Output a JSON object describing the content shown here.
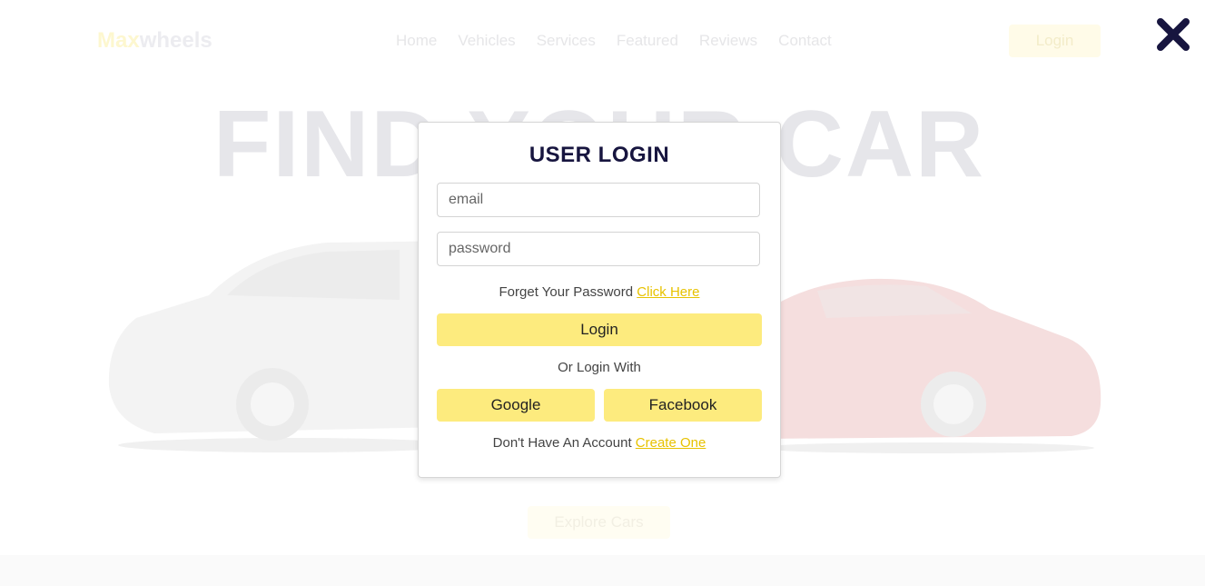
{
  "header": {
    "logo_part1": "Max",
    "logo_part2": "wheels",
    "nav": [
      "Home",
      "Vehicles",
      "Services",
      "Featured",
      "Reviews",
      "Contact"
    ],
    "login_label": "Login"
  },
  "hero": {
    "title": "FIND YOUR CAR",
    "explore_label": "Explore Cars"
  },
  "modal": {
    "title": "USER LOGIN",
    "email_placeholder": "email",
    "password_placeholder": "password",
    "forgot_text": "Forget Your Password",
    "forgot_link": "Click Here",
    "login_button": "Login",
    "or_text": "Or Login With",
    "google_button": "Google",
    "facebook_button": "Facebook",
    "signup_text": "Don't Have An Account",
    "signup_link": "Create One"
  },
  "icons": {
    "close": "close-icon"
  },
  "colors": {
    "accent": "#fdeb7e",
    "link": "#e7c200",
    "title": "#17153f",
    "close_icon": "#17153f"
  }
}
